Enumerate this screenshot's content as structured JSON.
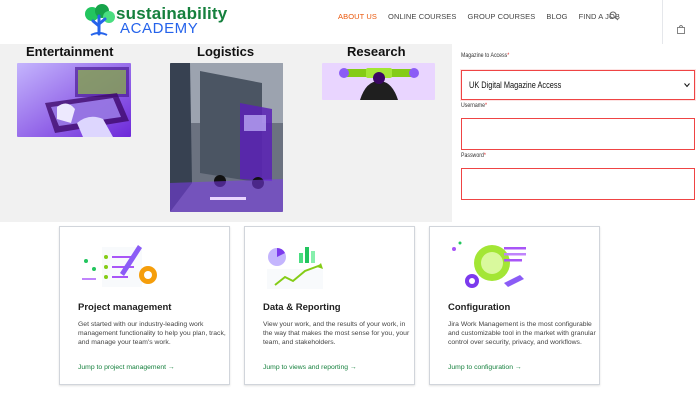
{
  "header": {
    "logo_top": "sustainability",
    "logo_bottom": "ACADEMY",
    "nav": [
      {
        "label": "ABOUT US",
        "active": true
      },
      {
        "label": "ONLINE COURSES",
        "active": false
      },
      {
        "label": "GROUP COURSES",
        "active": false
      },
      {
        "label": "BLOG",
        "active": false
      },
      {
        "label": "FIND A JOB",
        "active": false
      }
    ]
  },
  "sectors": [
    {
      "title": "Entertainment",
      "image": "laptop-stock-photo"
    },
    {
      "title": "Logistics",
      "image": "truck-stock-photo"
    },
    {
      "title": "Research",
      "image": "person-holding-tube-stock-photo"
    }
  ],
  "form": {
    "access_label": "Magazine to Access",
    "access_value": "UK Digital Magazine Access",
    "username_label": "Username",
    "password_label": "Password",
    "username_value": "",
    "password_value": "",
    "required_mark": "*",
    "error_color": "#ef4444"
  },
  "cards": [
    {
      "title": "Project management",
      "description": "Get started with our industry-leading work management functionality to help you plan, track, and manage your team's work.",
      "link": "Jump to project management →",
      "icon": "checklist-gear-icon"
    },
    {
      "title": "Data & Reporting",
      "description": "View your work, and the results of your work, in the way that makes the most sense for you, your team, and stakeholders.",
      "link": "Jump to views and reporting →",
      "icon": "charts-icon"
    },
    {
      "title": "Configuration",
      "description": "Jira Work Management is the most configurable and customizable tool in the market with granular control over security, privacy, and workflows.",
      "link": "Jump to configuration →",
      "icon": "gears-wrench-icon"
    }
  ],
  "colors": {
    "brand_green": "#15803d",
    "brand_blue": "#2563eb",
    "nav_active": "#ea580c",
    "accent_purple": "#7c3aed",
    "accent_lime": "#84cc16"
  }
}
